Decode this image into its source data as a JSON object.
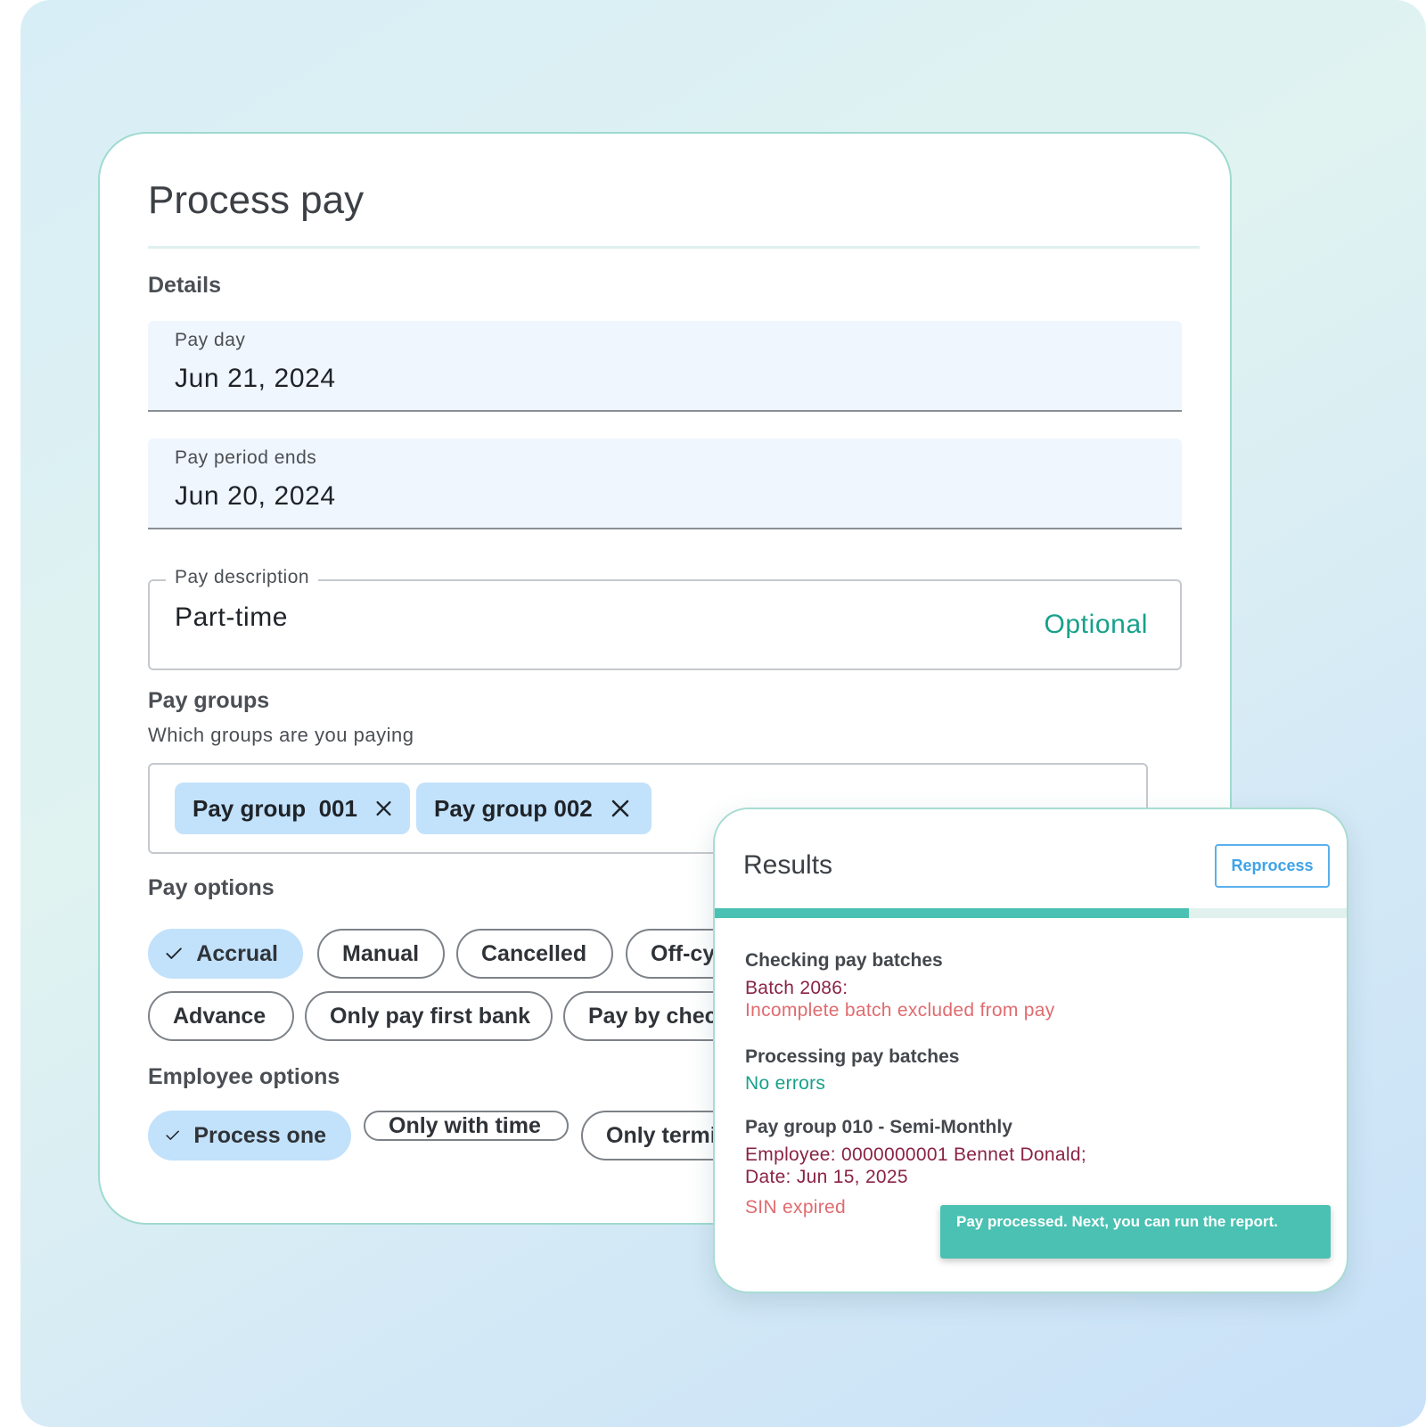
{
  "form": {
    "title": "Process pay",
    "details_heading": "Details",
    "pay_day": {
      "label": "Pay day",
      "value": "Jun 21, 2024"
    },
    "pay_period_ends": {
      "label": "Pay period ends",
      "value": "Jun 20, 2024"
    },
    "pay_description": {
      "label": "Pay description",
      "value": "Part-time",
      "hint": "Optional"
    },
    "pay_groups": {
      "heading": "Pay groups",
      "helper": "Which groups are you paying",
      "chips": [
        "Pay group  001",
        "Pay group 002"
      ]
    },
    "pay_options": {
      "heading": "Pay options",
      "row1": [
        {
          "label": "Accrual",
          "selected": true
        },
        {
          "label": "Manual",
          "selected": false
        },
        {
          "label": "Cancelled",
          "selected": false
        },
        {
          "label": "Off-cy",
          "selected": false
        }
      ],
      "row2": [
        {
          "label": "Advance",
          "selected": false
        },
        {
          "label": "Only pay first bank",
          "selected": false
        },
        {
          "label": "Pay by chec",
          "selected": false
        }
      ]
    },
    "employee_options": {
      "heading": "Employee options",
      "items": [
        {
          "label": "Process one",
          "selected": true
        },
        {
          "label": "Only with time",
          "selected": false
        },
        {
          "label": "Only termi",
          "selected": false
        }
      ]
    }
  },
  "results": {
    "title": "Results",
    "reprocess_label": "Reprocess",
    "progress_percent": 75,
    "sections": {
      "checking": {
        "heading": "Checking pay batches",
        "batch": "Batch 2086:",
        "message": "Incomplete batch excluded from pay"
      },
      "processing": {
        "heading": "Processing pay batches",
        "message": "No errors"
      },
      "group": {
        "heading": "Pay group 010 - Semi-Monthly",
        "employee": "Employee: 0000000001 Bennet Donald;",
        "date": "Date: Jun 15, 2025",
        "error": "SIN expired"
      }
    },
    "toast": "Pay processed. Next, you can run the report."
  },
  "colors": {
    "accent_teal": "#4ac1b2",
    "chip_blue": "#c2e1fb",
    "link_blue": "#3ea3e8",
    "success_green": "#17a08a",
    "error_red": "#e06b6f",
    "detail_maroon": "#8a2344"
  },
  "icons": {
    "chip_remove": "close-icon",
    "selected_option": "check-icon"
  }
}
